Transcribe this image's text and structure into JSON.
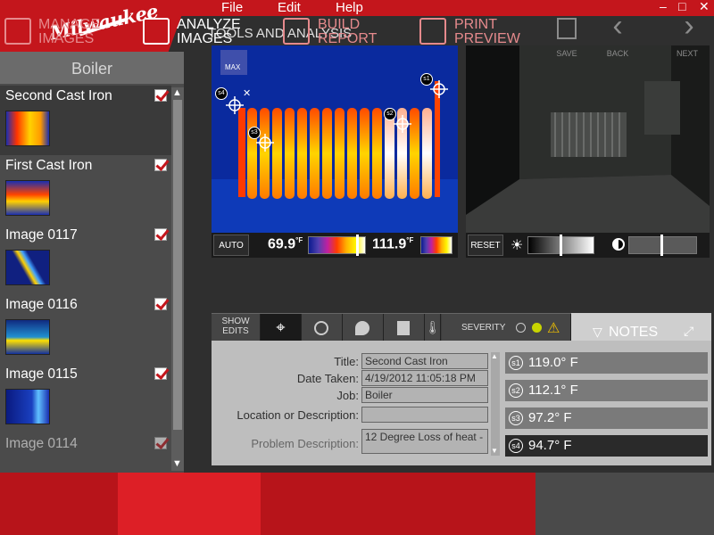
{
  "app": {
    "brand": "Milwaukee"
  },
  "menu": {
    "file": "File",
    "edit": "Edit",
    "help": "Help"
  },
  "window": {
    "minimize": "–",
    "maximize": "□",
    "close": "✕"
  },
  "section_title": "TOOLS AND ANALYSIS",
  "sidebar": {
    "header": "Boiler",
    "items": [
      {
        "label": "Second Cast Iron",
        "checked": true,
        "selected": true
      },
      {
        "label": "First Cast Iron",
        "checked": true
      },
      {
        "label": "Image 0117",
        "checked": true
      },
      {
        "label": "Image 0116",
        "checked": true
      },
      {
        "label": "Image 0115",
        "checked": true
      },
      {
        "label": "Image 0114",
        "checked": true
      }
    ]
  },
  "thermal": {
    "max_label": "MAX",
    "auto_label": "AUTO",
    "temp_min": "69.9",
    "temp_max": "111.9",
    "unit_deg": "°",
    "unit_f": "F",
    "spots": [
      "s1",
      "s2",
      "s3",
      "s4"
    ]
  },
  "visual": {
    "reset_label": "RESET"
  },
  "toolbar": {
    "show_edits": "SHOW EDITS",
    "severity": "SEVERITY"
  },
  "notes": {
    "label": "NOTES"
  },
  "details": {
    "title_label": "Title:",
    "title_value": "Second Cast Iron",
    "date_label": "Date Taken:",
    "date_value": "4/19/2012 11:05:18 PM",
    "job_label": "Job:",
    "job_value": "Boiler",
    "location_label": "Location or Description:",
    "location_value": "",
    "problem_label": "Problem Description:",
    "problem_value": "12 Degree Loss of heat -"
  },
  "spot_readings": [
    {
      "id": "s1",
      "value": "119.0° F"
    },
    {
      "id": "s2",
      "value": "112.1° F"
    },
    {
      "id": "s3",
      "value": "97.2° F"
    },
    {
      "id": "s4",
      "value": "94.7° F"
    }
  ],
  "nav": {
    "manage": [
      "MANAGE",
      "IMAGES"
    ],
    "analyze": [
      "ANALYZE",
      "IMAGES"
    ],
    "build": [
      "BUILD",
      "REPORT"
    ],
    "print": [
      "PRINT",
      "PREVIEW"
    ],
    "save": "SAVE",
    "back": "BACK",
    "next": "NEXT"
  },
  "colors": {
    "brand_red": "#c4161c",
    "active_red": "#dd1f26"
  }
}
